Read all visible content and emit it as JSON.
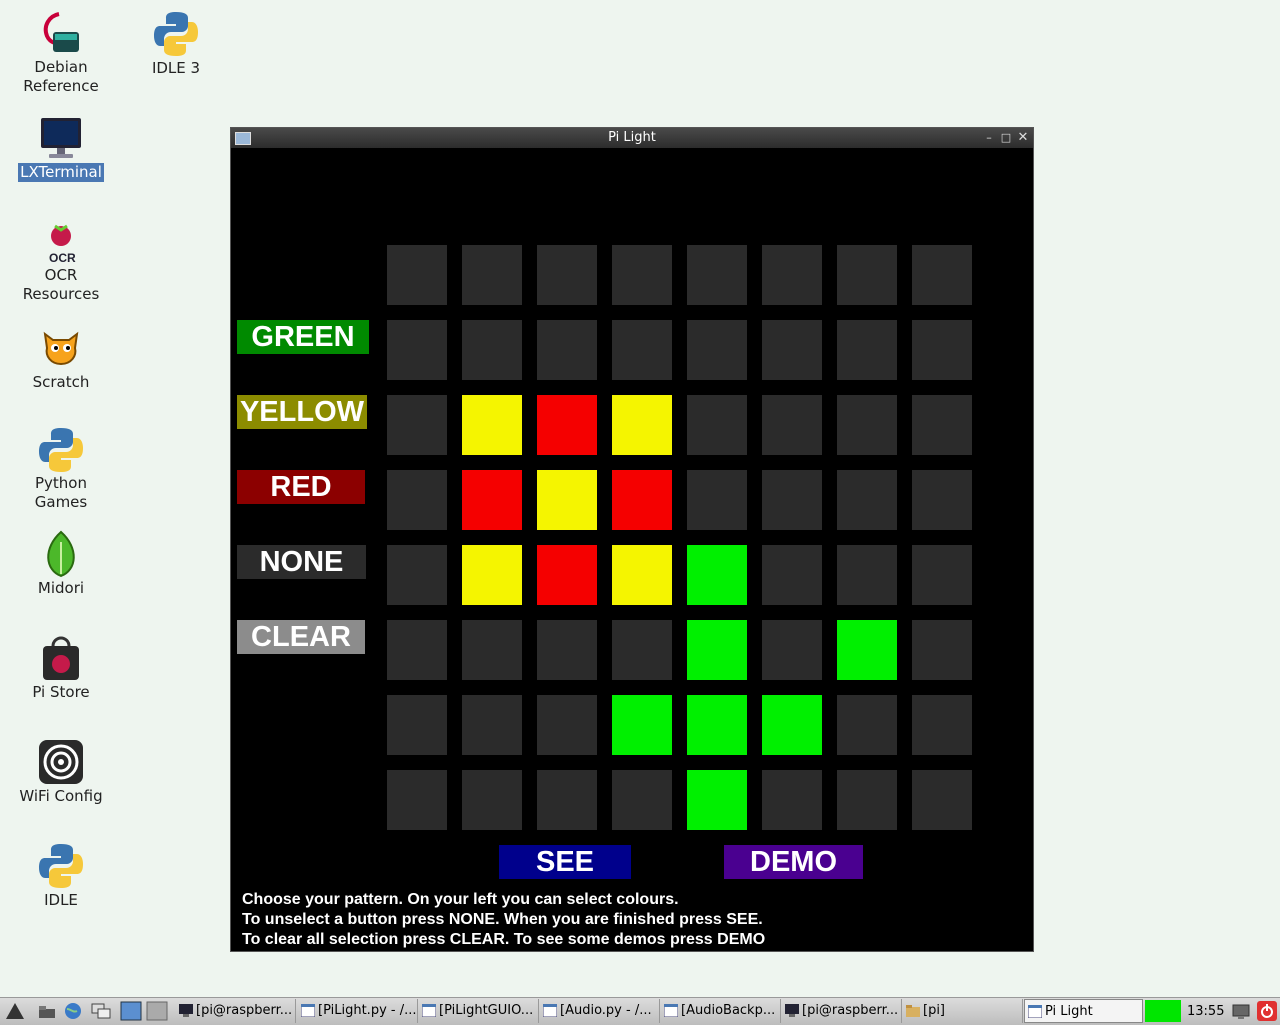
{
  "desktop": {
    "icons": [
      {
        "label": "Debian\nReference",
        "icon": "debian-reference-icon"
      },
      {
        "label": "IDLE 3",
        "icon": "python-icon"
      },
      {
        "label": "LXTerminal",
        "icon": "terminal-icon"
      },
      {
        "label": "OCR\nResources",
        "icon": "raspberry-pi-icon"
      },
      {
        "label": "Scratch",
        "icon": "scratch-cat-icon"
      },
      {
        "label": "Python\nGames",
        "icon": "python-icon"
      },
      {
        "label": "Midori",
        "icon": "midori-leaf-icon"
      },
      {
        "label": "Pi Store",
        "icon": "pi-store-bag-icon"
      },
      {
        "label": "WiFi Config",
        "icon": "wifi-icon"
      },
      {
        "label": "IDLE",
        "icon": "python-icon"
      }
    ]
  },
  "window": {
    "title": "Pi Light",
    "colour_buttons": {
      "green": "GREEN",
      "yellow": "YELLOW",
      "red": "RED",
      "none": "NONE",
      "clear": "CLEAR"
    },
    "grid": [
      [
        "off",
        "off",
        "off",
        "off",
        "off",
        "off",
        "off",
        "off"
      ],
      [
        "off",
        "off",
        "off",
        "off",
        "off",
        "off",
        "off",
        "off"
      ],
      [
        "off",
        "yellow",
        "red",
        "yellow",
        "off",
        "off",
        "off",
        "off"
      ],
      [
        "off",
        "red",
        "yellow",
        "red",
        "off",
        "off",
        "off",
        "off"
      ],
      [
        "off",
        "yellow",
        "red",
        "yellow",
        "green",
        "off",
        "off",
        "off"
      ],
      [
        "off",
        "off",
        "off",
        "off",
        "green",
        "off",
        "green",
        "off"
      ],
      [
        "off",
        "off",
        "off",
        "green",
        "green",
        "green",
        "off",
        "off"
      ],
      [
        "off",
        "off",
        "off",
        "off",
        "green",
        "off",
        "off",
        "off"
      ]
    ],
    "cell_colors": {
      "off": "#2b2b2b",
      "yellow": "#f5f500",
      "red": "#f50000",
      "green": "#00f000"
    },
    "see_label": "SEE",
    "demo_label": "DEMO",
    "instructions": [
      "Choose your pattern. On your left you can select colours.",
      "To unselect a button press NONE. When you are finished press SEE.",
      "To clear all selection press CLEAR. To see some demos press DEMO"
    ]
  },
  "taskbar": {
    "tasks": [
      {
        "label": "[pi@raspberr...",
        "icon": "terminal-icon"
      },
      {
        "label": "[PiLight.py - /...",
        "icon": "window-icon"
      },
      {
        "label": "[PiLightGUIO...",
        "icon": "window-icon"
      },
      {
        "label": "[Audio.py - /...",
        "icon": "window-icon"
      },
      {
        "label": "[AudioBackp...",
        "icon": "window-icon"
      },
      {
        "label": "[pi@raspberr...",
        "icon": "terminal-icon"
      },
      {
        "label": "[pi]",
        "icon": "folder-icon"
      },
      {
        "label": "Pi Light",
        "icon": "window-icon"
      }
    ],
    "clock": "13:55"
  }
}
